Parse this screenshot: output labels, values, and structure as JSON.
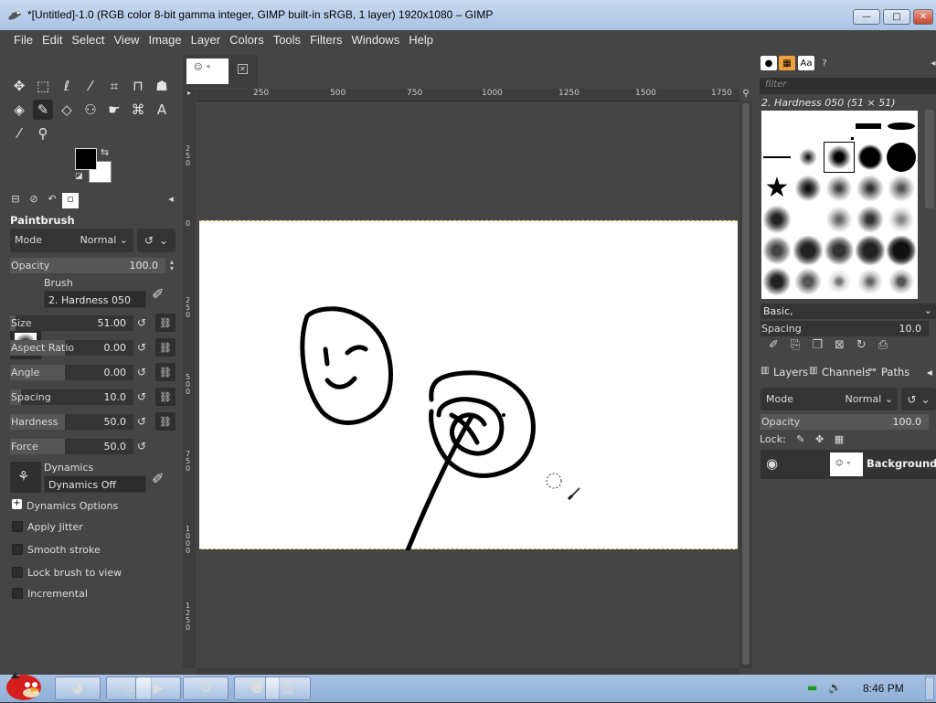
{
  "window": {
    "title": "*[Untitled]-1.0 (RGB color 8-bit gamma integer, GIMP built-in sRGB, 1 layer) 1920x1080 – GIMP",
    "controls": {
      "minimize": "—",
      "maximize": "□",
      "close": "✕"
    }
  },
  "menubar": [
    "File",
    "Edit",
    "Select",
    "View",
    "Image",
    "Layer",
    "Colors",
    "Tools",
    "Filters",
    "Windows",
    "Help"
  ],
  "colors": {
    "foreground": "#000000",
    "background": "#ffffff",
    "accent": "#454545"
  },
  "tool_options": {
    "title": "Paintbrush",
    "mode_label": "Mode",
    "mode_value": "Normal",
    "opacity": {
      "label": "Opacity",
      "value": "100.0",
      "fraction": 1.0
    },
    "brush_label": "Brush",
    "brush_value": "2. Hardness 050",
    "size": {
      "label": "Size",
      "value": "51.00",
      "fraction": 0.05
    },
    "aspect": {
      "label": "Aspect Ratio",
      "value": "0.00",
      "fraction": 0.5
    },
    "angle": {
      "label": "Angle",
      "value": "0.00",
      "fraction": 0.5
    },
    "spacing": {
      "label": "Spacing",
      "value": "10.0",
      "fraction": 0.1
    },
    "hardness": {
      "label": "Hardness",
      "value": "50.0",
      "fraction": 0.5
    },
    "force": {
      "label": "Force",
      "value": "50.0",
      "fraction": 0.5
    },
    "dynamics_label": "Dynamics",
    "dynamics_value": "Dynamics Off",
    "dynamics_options": "Dynamics Options",
    "apply_jitter": "Apply Jitter",
    "smooth_stroke": "Smooth stroke",
    "lock_brush": "Lock brush to view",
    "incremental": "Incremental"
  },
  "ruler": {
    "h": [
      "250",
      "500",
      "750",
      "1000",
      "1250",
      "1500",
      "1750"
    ],
    "v": [
      "250",
      "0",
      "250",
      "500",
      "750",
      "1000",
      "1250"
    ]
  },
  "brushes": {
    "filter_placeholder": "filter",
    "selected": "2. Hardness 050 (51 × 51)",
    "set": "Basic,",
    "spacing_label": "Spacing",
    "spacing_value": "10.0"
  },
  "layers": {
    "tabs": [
      "Layers",
      "Channels",
      "Paths"
    ],
    "mode_label": "Mode",
    "mode_value": "Normal",
    "opacity_label": "Opacity",
    "opacity_value": "100.0",
    "lock_label": "Lock:",
    "layer_name": "Background"
  },
  "taskbar": {
    "clock": "8:46 PM"
  }
}
